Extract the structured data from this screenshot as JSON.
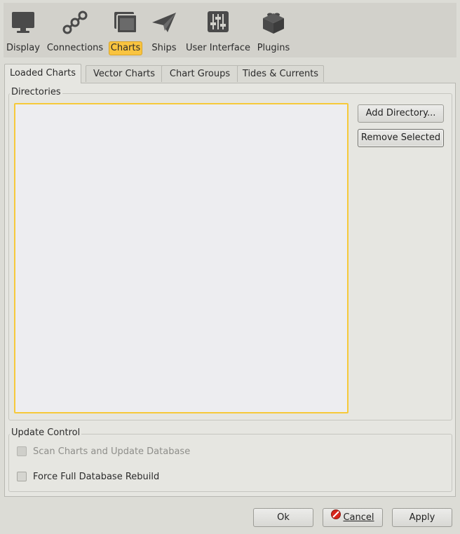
{
  "toolbar": {
    "items": [
      {
        "label": "Display",
        "icon": "monitor-icon"
      },
      {
        "label": "Connections",
        "icon": "connections-icon"
      },
      {
        "label": "Charts",
        "icon": "charts-icon",
        "selected": true
      },
      {
        "label": "Ships",
        "icon": "paper-plane-icon"
      },
      {
        "label": "User Interface",
        "icon": "sliders-icon"
      },
      {
        "label": "Plugins",
        "icon": "lego-brick-icon"
      }
    ],
    "selected_color": "#f9c440"
  },
  "tabs": [
    {
      "label": "Loaded Charts",
      "active": true
    },
    {
      "label": "Vector Charts"
    },
    {
      "label": "Chart Groups"
    },
    {
      "label": "Tides & Currents"
    }
  ],
  "directories": {
    "title": "Directories",
    "items": [],
    "add_button": "Add Directory...",
    "remove_button": "Remove Selected",
    "focus_color": "#f6c93a"
  },
  "update_control": {
    "title": "Update Control",
    "scan_label": "Scan Charts and Update Database",
    "scan_checked": false,
    "scan_disabled": true,
    "rebuild_label": "Force Full Database Rebuild",
    "rebuild_checked": false
  },
  "footer": {
    "ok": "Ok",
    "cancel": "Cancel",
    "cancel_icon": "cancel-icon",
    "apply": "Apply"
  }
}
